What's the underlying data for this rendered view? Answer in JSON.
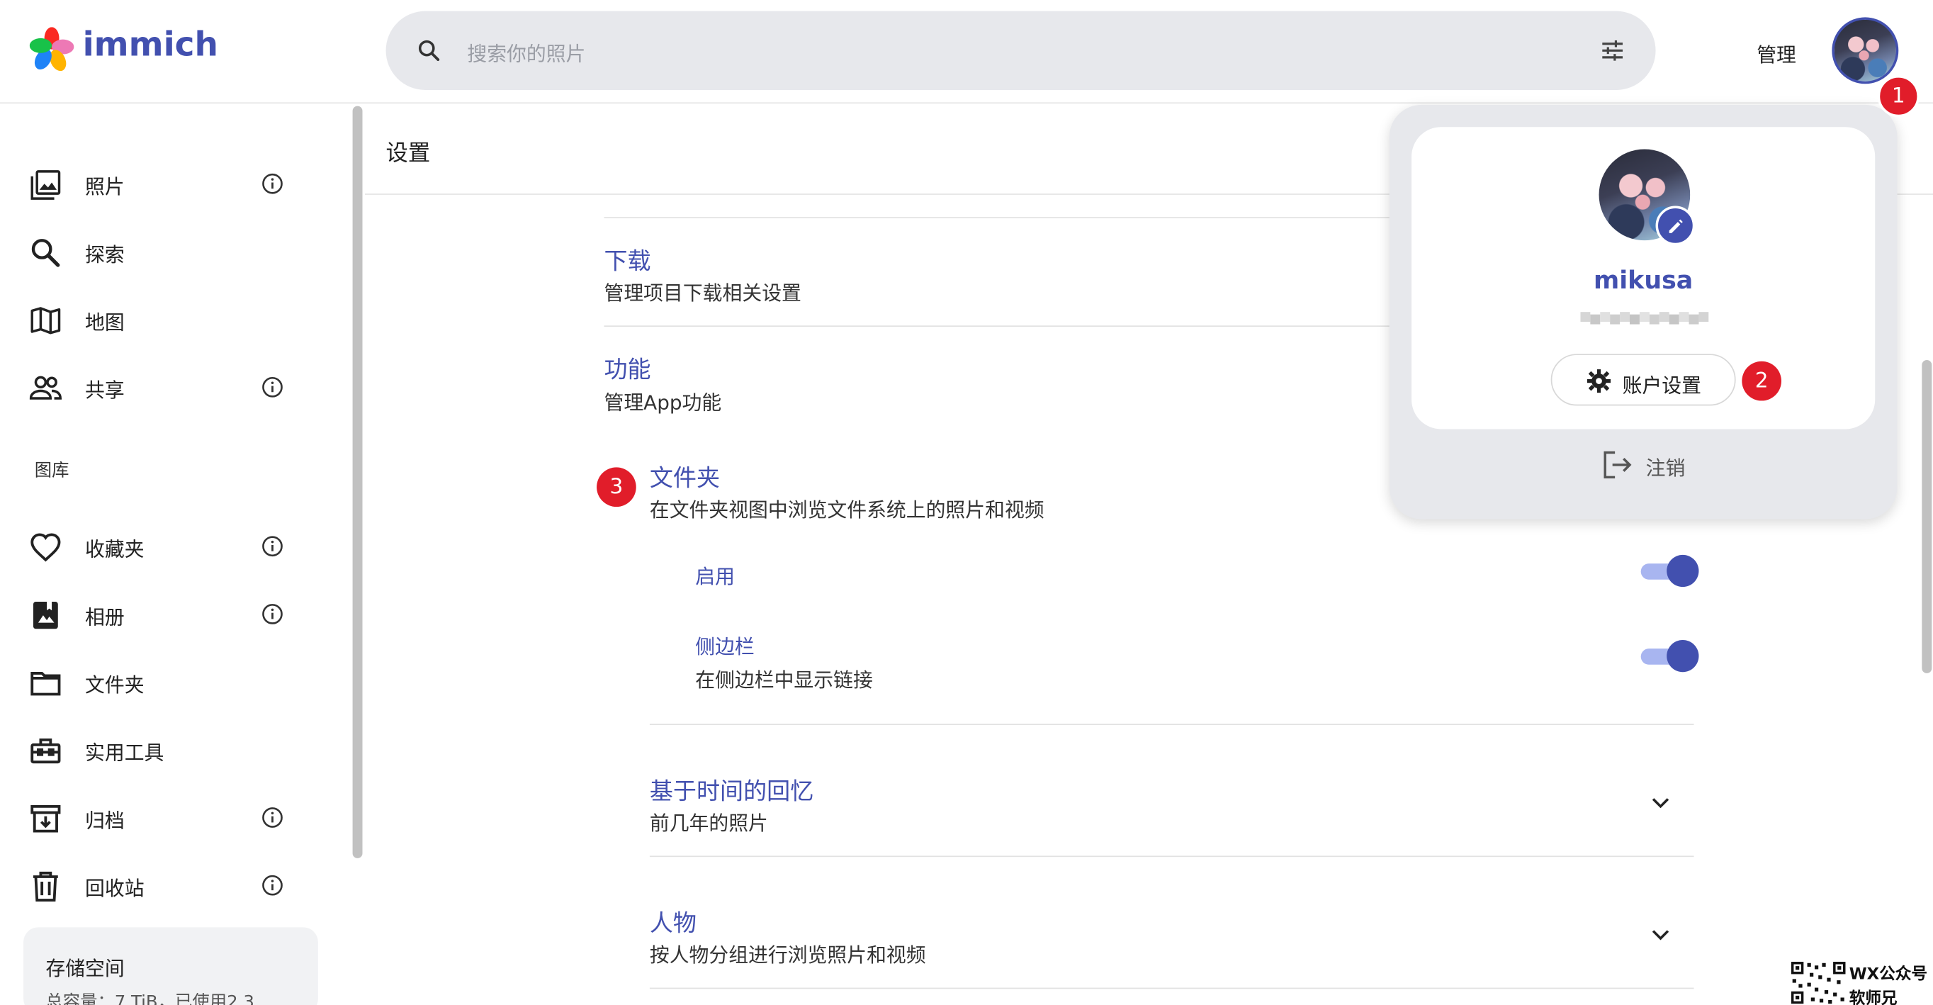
{
  "header": {
    "brand": "immich",
    "search_placeholder": "搜索你的照片",
    "admin_label": "管理"
  },
  "sidebar": {
    "items": [
      {
        "label": "照片"
      },
      {
        "label": "探索"
      },
      {
        "label": "地图"
      },
      {
        "label": "共享"
      },
      {
        "label": "收藏夹"
      },
      {
        "label": "相册"
      },
      {
        "label": "文件夹"
      },
      {
        "label": "实用工具"
      },
      {
        "label": "归档"
      },
      {
        "label": "回收站"
      }
    ],
    "library_heading": "图库",
    "storage": {
      "title": "存储空间",
      "detail": "总容量：7 TiB，已使用2.3"
    }
  },
  "main": {
    "page_title": "设置",
    "sections": {
      "download": {
        "title": "下载",
        "desc": "管理项目下载相关设置"
      },
      "features": {
        "title": "功能",
        "desc": "管理App功能"
      },
      "folders": {
        "title": "文件夹",
        "desc": "在文件夹视图中浏览文件系统上的照片和视频"
      },
      "memories": {
        "title": "基于时间的回忆",
        "desc": "前几年的照片"
      },
      "people": {
        "title": "人物",
        "desc": "按人物分组进行浏览照片和视频"
      }
    },
    "folders_options": {
      "enable": {
        "label": "启用"
      },
      "sidebar": {
        "label": "侧边栏",
        "desc": "在侧边栏中显示链接"
      }
    }
  },
  "account_popup": {
    "username": "mikusa",
    "account_settings_label": "账户设置",
    "logout_label": "注销"
  },
  "annotations": {
    "badge1": "1",
    "badge2": "2",
    "badge3": "3"
  },
  "watermark": {
    "line1": "WX公众号",
    "line2": "软师兄"
  },
  "colors": {
    "accent": "#4250af",
    "badge": "#e11d2a",
    "toggle_track": "#a8b5f0"
  }
}
